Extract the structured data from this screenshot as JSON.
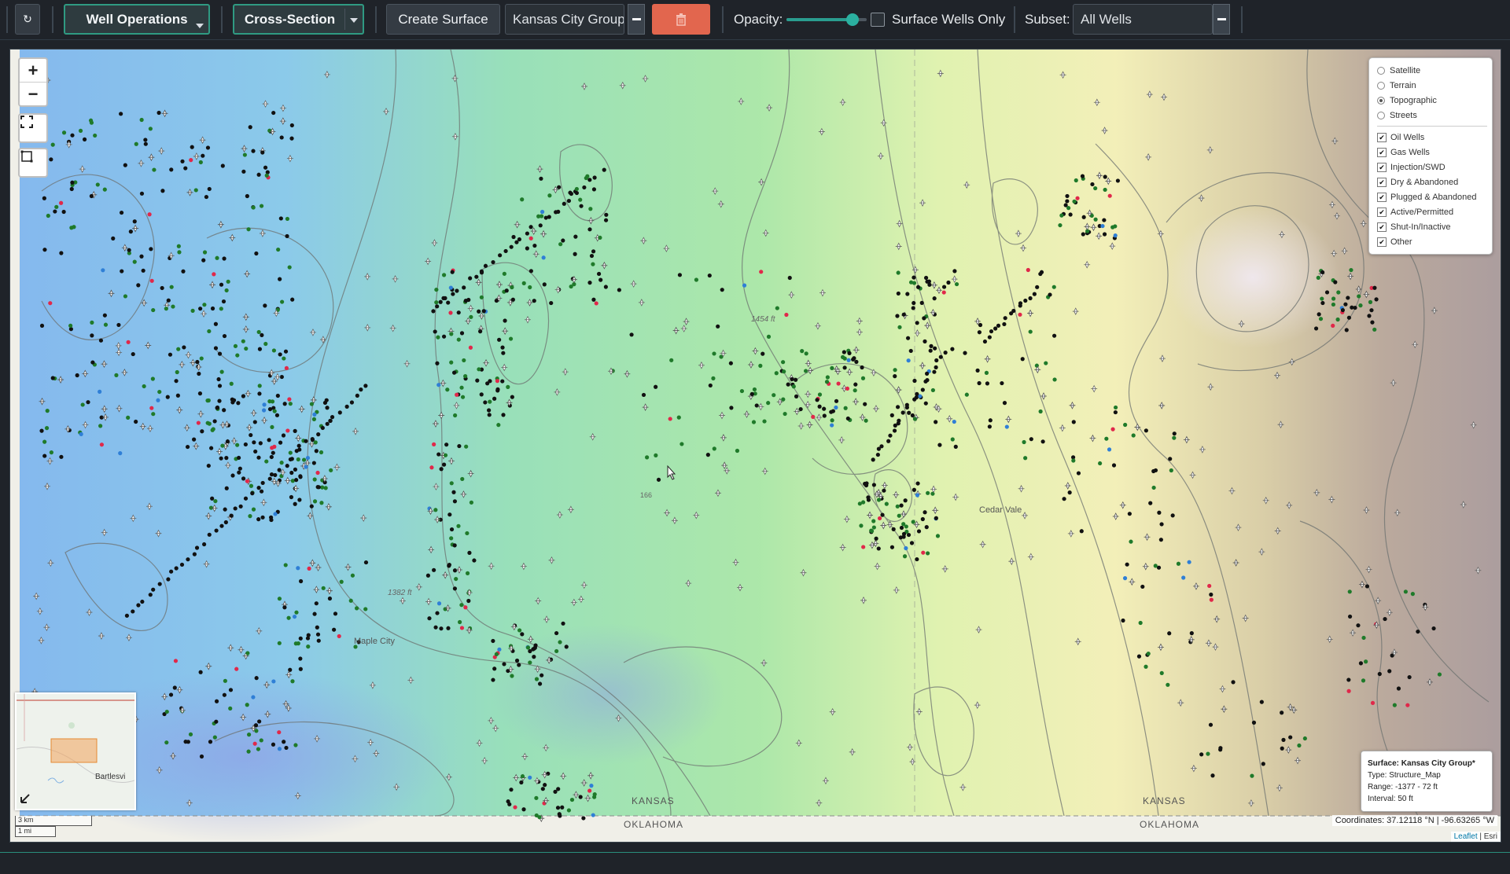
{
  "toolbar": {
    "well_operations_label": "Well Operations",
    "cross_section_label": "Cross-Section",
    "create_surface_label": "Create Surface",
    "surface_select_value": "Kansas City Group*",
    "opacity_label": "Opacity:",
    "opacity_value": 0.82,
    "surface_wells_only_label": "Surface Wells Only",
    "subset_label": "Subset:",
    "subset_value": "All Wells",
    "accent_color": "#2f9a82",
    "delete_color": "#e2664e"
  },
  "map": {
    "zoom_in": "+",
    "zoom_out": "−",
    "basemaps": [
      {
        "label": "Satellite",
        "selected": false
      },
      {
        "label": "Terrain",
        "selected": false
      },
      {
        "label": "Topographic",
        "selected": true
      },
      {
        "label": "Streets",
        "selected": false
      }
    ],
    "overlays": [
      "Oil Wells",
      "Gas Wells",
      "Injection/SWD",
      "Dry & Abandoned",
      "Plugged & Abandoned",
      "Active/Permitted",
      "Shut-In/Inactive",
      "Other"
    ],
    "place_labels": {
      "cedar_vale": "Cedar Vale",
      "maple_city": "Maple City",
      "kansas_left": "KANSAS",
      "oklahoma_left": "OKLAHOMA",
      "kansas_right": "KANSAS",
      "oklahoma_right": "OKLAHOMA",
      "contour_1454": "1454 ft",
      "contour_1382": "1382 ft",
      "road_166": "166"
    },
    "minimap_label": "Bartlesvi",
    "scale_km": "3 km",
    "scale_mi": "1 mi",
    "info": {
      "surface_line": "Surface: Kansas City Group*",
      "type_line": "Type: Structure_Map",
      "range_line": "Range: -1377 - 72 ft",
      "interval_line": "Interval: 50 ft"
    },
    "coordinates": "Coordinates: 37.12118 °N | -96.63265 °W",
    "attribution_leaflet": "Leaflet",
    "attribution_esri": "| Esri"
  }
}
